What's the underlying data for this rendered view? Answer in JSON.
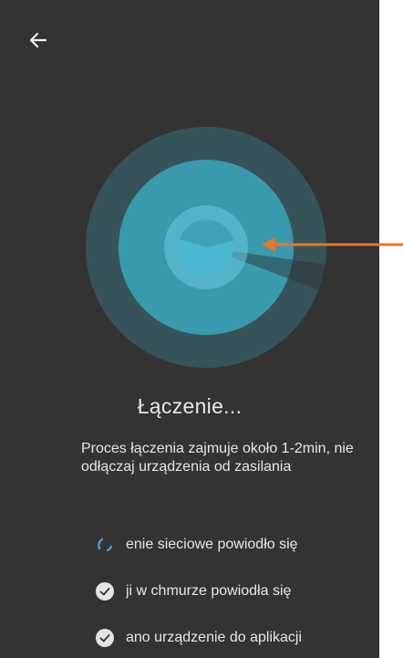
{
  "header": {
    "back_icon": "arrow-left-icon"
  },
  "status": {
    "title": "Łączenie...",
    "description": "Proces łączenia zajmuje około 1-2min, nie odłączaj urządzenia od zasilania"
  },
  "steps": [
    {
      "label": "enie sieciowe powiodło się",
      "state": "in-progress",
      "icon": "spinner-icon"
    },
    {
      "label": "ji w chmurze powiodła się",
      "state": "pending",
      "icon": "check-circle-icon"
    },
    {
      "label": "ano urządzenie do aplikacji",
      "state": "pending",
      "icon": "check-circle-icon"
    }
  ],
  "colors": {
    "background": "#333333",
    "accent": "#3fb6cf",
    "annotation_arrow": "#e8772a"
  }
}
